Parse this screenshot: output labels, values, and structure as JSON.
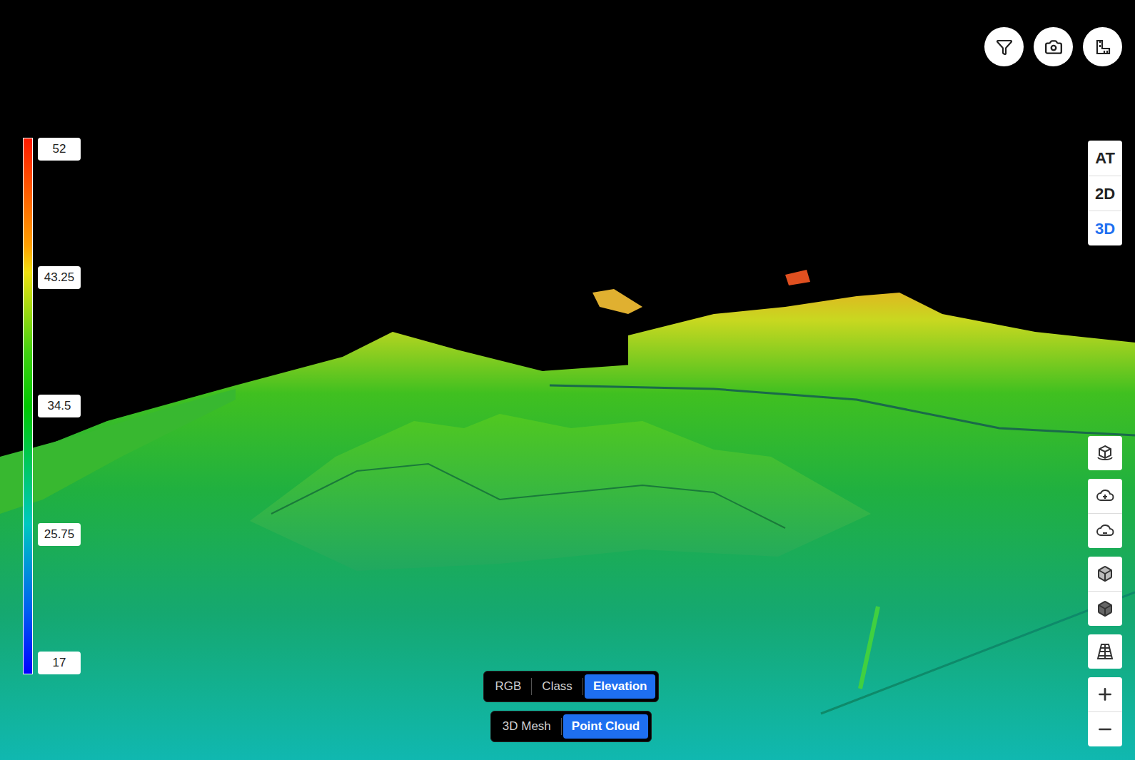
{
  "legend": {
    "ticks": [
      "52",
      "43.25",
      "34.5",
      "25.75",
      "17"
    ]
  },
  "view_modes": [
    {
      "label": "AT",
      "selected": false
    },
    {
      "label": "2D",
      "selected": false
    },
    {
      "label": "3D",
      "selected": true
    }
  ],
  "color_modes": [
    {
      "label": "RGB",
      "selected": false
    },
    {
      "label": "Class",
      "selected": false
    },
    {
      "label": "Elevation",
      "selected": true
    }
  ],
  "render_modes": [
    {
      "label": "3D Mesh",
      "selected": false
    },
    {
      "label": "Point Cloud",
      "selected": true
    }
  ]
}
